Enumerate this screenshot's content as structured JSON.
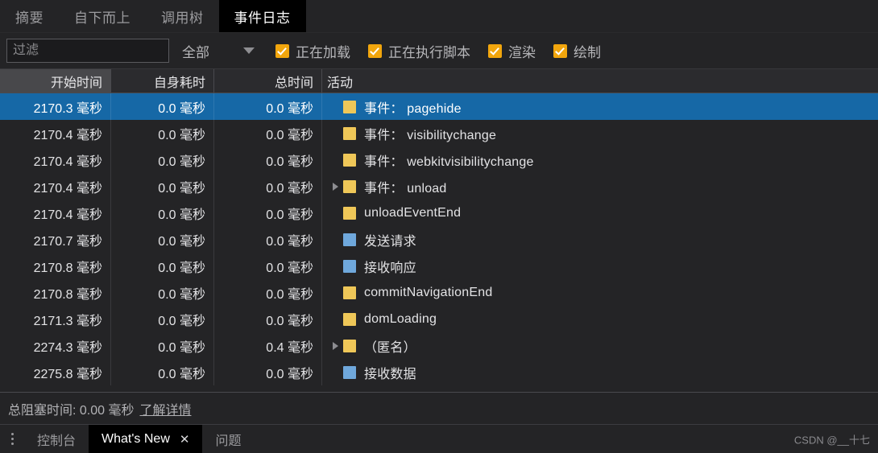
{
  "tabs": [
    {
      "label": "摘要",
      "active": false
    },
    {
      "label": "自下而上",
      "active": false
    },
    {
      "label": "调用树",
      "active": false
    },
    {
      "label": "事件日志",
      "active": true
    }
  ],
  "toolbar": {
    "filter_value": "",
    "filter_placeholder": "过滤",
    "dropdown_value": "全部",
    "caret_icon": "chevron-down-icon",
    "checkboxes": [
      {
        "label": "正在加载",
        "checked": true
      },
      {
        "label": "正在执行脚本",
        "checked": true
      },
      {
        "label": "渲染",
        "checked": true
      },
      {
        "label": "绘制",
        "checked": true
      }
    ],
    "checkbox_color": "#f2a60d"
  },
  "table": {
    "columns": [
      {
        "label": "开始时间",
        "sorted": true
      },
      {
        "label": "自身耗时",
        "sorted": false
      },
      {
        "label": "总时间",
        "sorted": false
      },
      {
        "label": "活动",
        "sorted": false
      }
    ],
    "colors": {
      "loading": "#efc758",
      "scripting": "#efc758",
      "network": "#6fa8dc",
      "selection": "#1668a6"
    },
    "rows": [
      {
        "start": "2170.3 毫秒",
        "self": "0.0 毫秒",
        "total": "0.0 毫秒",
        "expandable": false,
        "swatch": "#efc758",
        "activity": "事件： pagehide",
        "selected": true
      },
      {
        "start": "2170.4 毫秒",
        "self": "0.0 毫秒",
        "total": "0.0 毫秒",
        "expandable": false,
        "swatch": "#efc758",
        "activity": "事件： visibilitychange",
        "selected": false
      },
      {
        "start": "2170.4 毫秒",
        "self": "0.0 毫秒",
        "total": "0.0 毫秒",
        "expandable": false,
        "swatch": "#efc758",
        "activity": "事件： webkitvisibilitychange",
        "selected": false
      },
      {
        "start": "2170.4 毫秒",
        "self": "0.0 毫秒",
        "total": "0.0 毫秒",
        "expandable": true,
        "swatch": "#efc758",
        "activity": "事件： unload",
        "selected": false
      },
      {
        "start": "2170.4 毫秒",
        "self": "0.0 毫秒",
        "total": "0.0 毫秒",
        "expandable": false,
        "swatch": "#efc758",
        "activity": "unloadEventEnd",
        "selected": false
      },
      {
        "start": "2170.7 毫秒",
        "self": "0.0 毫秒",
        "total": "0.0 毫秒",
        "expandable": false,
        "swatch": "#6fa8dc",
        "activity": "发送请求",
        "selected": false
      },
      {
        "start": "2170.8 毫秒",
        "self": "0.0 毫秒",
        "total": "0.0 毫秒",
        "expandable": false,
        "swatch": "#6fa8dc",
        "activity": "接收响应",
        "selected": false
      },
      {
        "start": "2170.8 毫秒",
        "self": "0.0 毫秒",
        "total": "0.0 毫秒",
        "expandable": false,
        "swatch": "#efc758",
        "activity": "commitNavigationEnd",
        "selected": false
      },
      {
        "start": "2171.3 毫秒",
        "self": "0.0 毫秒",
        "total": "0.0 毫秒",
        "expandable": false,
        "swatch": "#efc758",
        "activity": "domLoading",
        "selected": false
      },
      {
        "start": "2274.3 毫秒",
        "self": "0.0 毫秒",
        "total": "0.4 毫秒",
        "expandable": true,
        "swatch": "#efc758",
        "activity": "（匿名）",
        "selected": false
      },
      {
        "start": "2275.8 毫秒",
        "self": "0.0 毫秒",
        "total": "0.0 毫秒",
        "expandable": false,
        "swatch": "#6fa8dc",
        "activity": "接收数据",
        "selected": false
      }
    ]
  },
  "summary": {
    "text": "总阻塞时间: 0.00 毫秒",
    "link": "了解详情"
  },
  "drawer": {
    "menu_icon": "kebab-menu-icon",
    "tabs": [
      {
        "label": "控制台",
        "active": false,
        "closable": false
      },
      {
        "label": "What's New",
        "active": true,
        "closable": true
      },
      {
        "label": "问题",
        "active": false,
        "closable": false
      }
    ],
    "close_icon": "✕"
  },
  "watermark": "CSDN @__十七"
}
